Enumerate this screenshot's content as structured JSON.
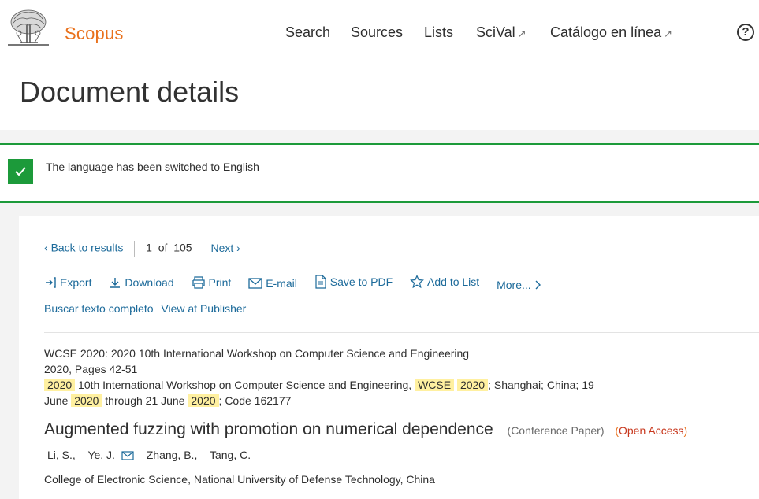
{
  "header": {
    "brand": "Scopus",
    "nav": [
      {
        "label": "Search",
        "external": false
      },
      {
        "label": "Sources",
        "external": false
      },
      {
        "label": "Lists",
        "external": false
      },
      {
        "label": "SciVal",
        "external": true
      },
      {
        "label": "Catálogo en línea",
        "external": true
      }
    ],
    "external_glyph": "↗",
    "help_glyph": "?"
  },
  "page_title": "Document details",
  "notice": {
    "text": "The language has been switched to English",
    "icon": "check-icon",
    "color": "#1c9a3a"
  },
  "pager": {
    "back": "Back to results",
    "current": "1",
    "of": "of",
    "total": "105",
    "next": "Next"
  },
  "actions": {
    "export": "Export",
    "download": "Download",
    "print": "Print",
    "email": "E-mail",
    "save_pdf": "Save to PDF",
    "add_list": "Add to List",
    "more": "More..."
  },
  "links": {
    "full_text": "Buscar texto completo",
    "publisher": "View at Publisher"
  },
  "source": {
    "line1": "WCSE 2020: 2020 10th International Workshop on Computer Science and Engineering",
    "line2": "2020, Pages 42-51",
    "l3_hl1": "2020",
    "l3_t1": " 10th International Workshop on Computer Science and Engineering, ",
    "l3_hl2": "WCSE",
    "l3_hl3": "2020",
    "l3_t2": "; Shanghai; China; 19",
    "l4_t1": "June ",
    "l4_hl1": "2020",
    "l4_t2": " through 21 June ",
    "l4_hl2": "2020",
    "l4_t3": "; Code 162177"
  },
  "document": {
    "title": "Augmented fuzzing with promotion on numerical dependence",
    "type": "(Conference Paper)",
    "open_access_open": "(",
    "open_access": "Open Access",
    "open_access_close": ")",
    "authors": [
      "Li, S.,",
      "Ye, J.",
      "Zhang, B.,",
      "Tang, C."
    ],
    "affiliation": "College of Electronic Science, National University of Defense Technology, China"
  },
  "colors": {
    "brand": "#e9711c",
    "link": "#1c6a9a",
    "success": "#1c9a3a",
    "highlight": "#fff0a0",
    "open_access": "#c8381e"
  }
}
